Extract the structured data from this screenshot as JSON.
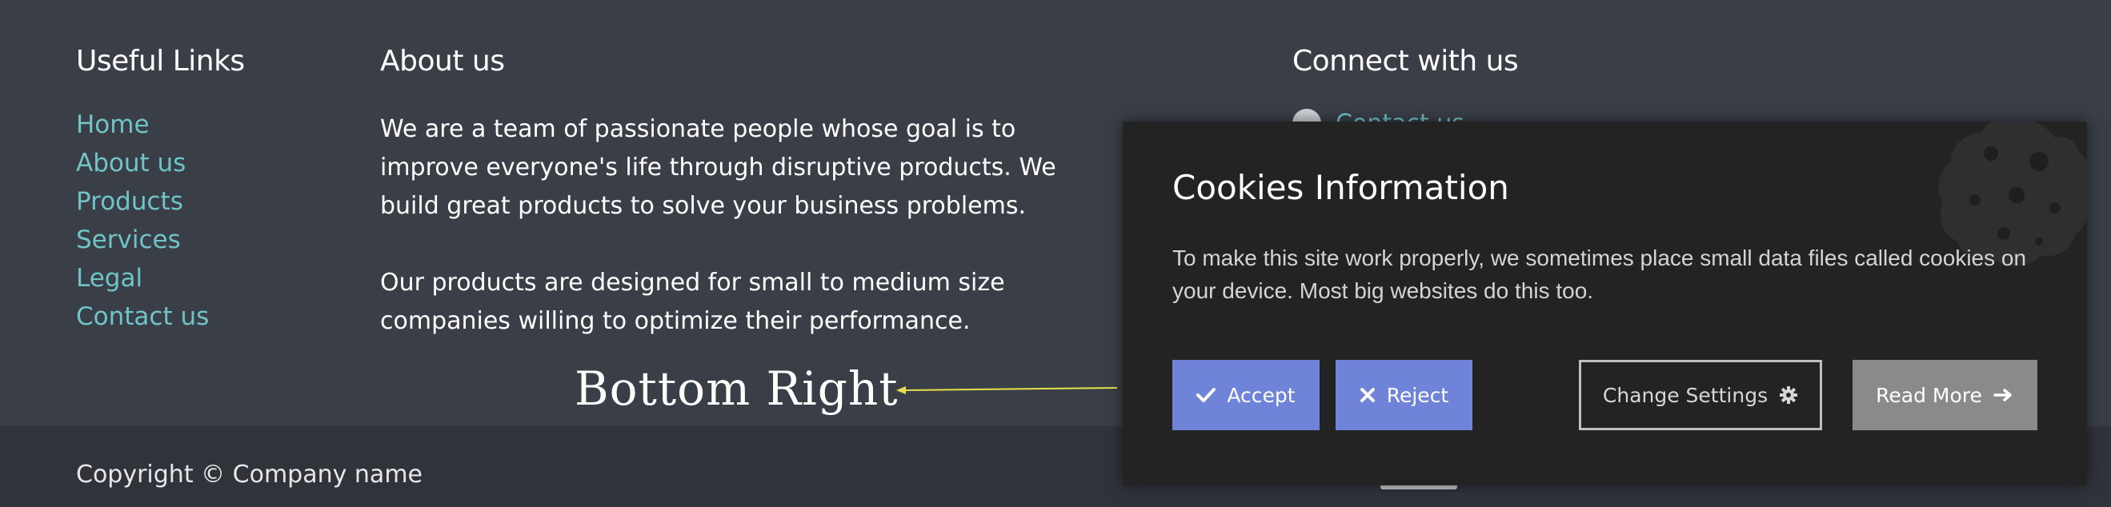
{
  "footer": {
    "useful_links": {
      "heading": "Useful Links",
      "items": [
        "Home",
        "About us",
        "Products",
        "Services",
        "Legal",
        "Contact us"
      ]
    },
    "about": {
      "heading": "About us",
      "paragraph1": "We are a team of passionate people whose goal is to improve everyone's life through disruptive products. We build great products to solve your business problems.",
      "paragraph2": "Our products are designed for small to medium size companies willing to optimize their performance."
    },
    "connect": {
      "heading": "Connect with us",
      "contact_label": "Contact us"
    },
    "copyright": "Copyright © Company name"
  },
  "annotation": {
    "label": "Bottom Right"
  },
  "cookie_banner": {
    "title": "Cookies Information",
    "message": "To make this site work properly, we sometimes place small data files called cookies on your device. Most big websites do this too.",
    "accept_label": "Accept",
    "reject_label": "Reject",
    "settings_label": "Change Settings",
    "read_more_label": "Read More"
  },
  "colors": {
    "page_bg": "#3a3f47",
    "footer_bottom_bg": "#30343a",
    "link": "#6fc4c8",
    "card_bg": "#232323",
    "primary_button": "#6f84d8",
    "read_more_button": "#8a8a8a",
    "arrow": "#e8e04a"
  },
  "icons": {
    "accept": "check-icon",
    "reject": "x-icon",
    "settings": "gear-icon",
    "read_more": "arrow-right-icon",
    "background": "cookie-icon"
  }
}
